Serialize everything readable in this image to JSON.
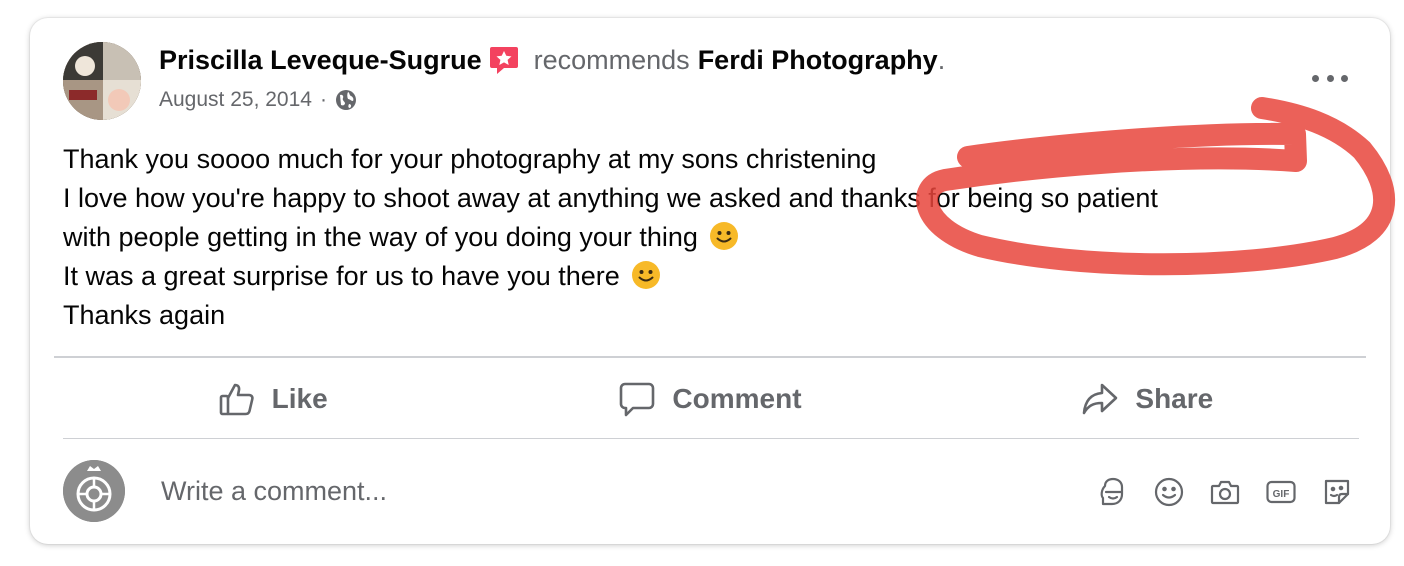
{
  "post": {
    "author": "Priscilla Leveque-Sugrue",
    "action_text": "recommends",
    "page_name": "Ferdi Photography",
    "period": ".",
    "date": "August 25, 2014",
    "separator": "·",
    "privacy_icon": "globe-icon",
    "body_lines": [
      "Thank you soooo much for your photography at my sons christening",
      "I love how you're happy to shoot away at anything we asked and thanks for being so patient",
      "with people getting in the way of you doing your thing",
      "It was a great surprise for us to have you there",
      "Thanks again"
    ]
  },
  "actions": {
    "like": "Like",
    "comment": "Comment",
    "share": "Share"
  },
  "comment_box": {
    "placeholder": "Write a comment..."
  },
  "icons": [
    "recommend-badge-icon",
    "globe-icon",
    "more-options-icon",
    "like-icon",
    "comment-icon",
    "share-icon",
    "avatar-sticker-icon",
    "emoji-icon",
    "camera-icon",
    "gif-icon",
    "sticker-icon"
  ],
  "colors": {
    "text": "#050505",
    "secondary": "#65676b",
    "divider": "#ced0d4",
    "recommend_badge": "#f3425f",
    "annotation_stroke": "#e8453c"
  }
}
